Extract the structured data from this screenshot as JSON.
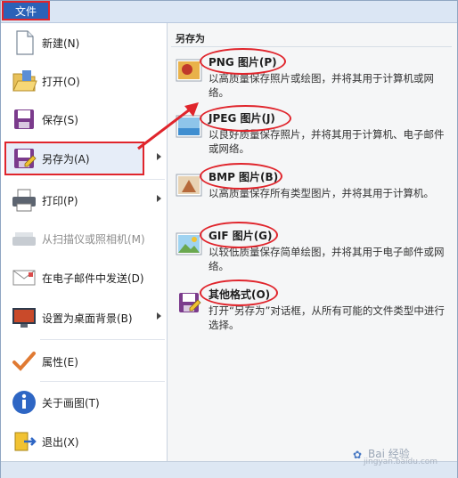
{
  "app": {
    "file_tab": "文件"
  },
  "left_menu": {
    "items": [
      {
        "label": "新建(N)",
        "icon": "new-document-icon",
        "disabled": false
      },
      {
        "label": "打开(O)",
        "icon": "open-folder-icon",
        "disabled": false
      },
      {
        "label": "保存(S)",
        "icon": "save-floppy-icon",
        "disabled": false
      },
      {
        "label": "另存为(A)",
        "icon": "save-as-icon",
        "disabled": false,
        "has_submenu": true,
        "selected": true
      },
      {
        "label": "打印(P)",
        "icon": "printer-icon",
        "disabled": false,
        "has_submenu": true
      },
      {
        "label": "从扫描仪或照相机(M)",
        "icon": "scanner-icon",
        "disabled": true
      },
      {
        "label": "在电子邮件中发送(D)",
        "icon": "email-icon",
        "disabled": false
      },
      {
        "label": "设置为桌面背景(B)",
        "icon": "desktop-background-icon",
        "disabled": false,
        "has_submenu": true
      },
      {
        "label": "属性(E)",
        "icon": "checkmark-icon",
        "disabled": false
      },
      {
        "label": "关于画图(T)",
        "icon": "info-icon",
        "disabled": false
      },
      {
        "label": "退出(X)",
        "icon": "exit-icon",
        "disabled": false
      }
    ]
  },
  "save_as_panel": {
    "heading": "另存为",
    "options": [
      {
        "title": "PNG 图片(P)",
        "description": "以高质量保存照片或绘图，并将其用于计算机或网络。",
        "icon": "png-image-icon"
      },
      {
        "title": "JPEG 图片(J)",
        "description": "以良好质量保存照片，并将其用于计算机、电子邮件或网络。",
        "icon": "jpeg-image-icon"
      },
      {
        "title": "BMP 图片(B)",
        "description": "以高质量保存所有类型图片，并将其用于计算机。",
        "icon": "bmp-image-icon"
      },
      {
        "title": "GIF 图片(G)",
        "description": "以较低质量保存简单绘图，并将其用于电子邮件或网络。",
        "icon": "gif-image-icon"
      },
      {
        "title": "其他格式(O)",
        "description": "打开“另存为”对话框，从所有可能的文件类型中进行选择。",
        "icon": "other-formats-icon"
      }
    ]
  },
  "watermark": {
    "text": "Bai 经验",
    "sub": "jingyan.baidu.com"
  },
  "colors": {
    "annotation_red": "#e0252c",
    "file_tab_blue": "#2b62b8"
  }
}
